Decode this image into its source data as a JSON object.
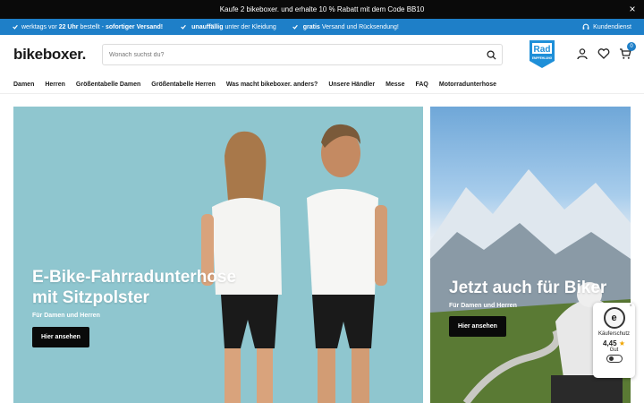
{
  "promo": {
    "text": "Kaufe 2 bikeboxer. und erhalte 10 % Rabatt mit dem Code BB10",
    "close_icon": "×"
  },
  "usp": {
    "items": [
      {
        "pre": "werktags vor",
        "bold": "22 Uhr",
        "post": "bestellt -",
        "bold2": "sofortiger Versand!"
      },
      {
        "pre": "",
        "bold": "unauffällig",
        "post": "unter der Kleidung",
        "bold2": ""
      },
      {
        "pre": "",
        "bold": "gratis",
        "post": "Versand und Rücksendung!",
        "bold2": ""
      }
    ],
    "service": "Kundendienst"
  },
  "header": {
    "logo": "bikeboxer.",
    "search_placeholder": "Wonach suchst du?",
    "badge_text": "Rad",
    "badge_sub": "EMPFEHLUNG",
    "cart_count": "0"
  },
  "nav": [
    "Damen",
    "Herren",
    "Größentabelle Damen",
    "Größentabelle Herren",
    "Was macht bikeboxer. anders?",
    "Unsere Händler",
    "Messe",
    "FAQ",
    "Motorradunterhose"
  ],
  "hero_left": {
    "title_line1": "E-Bike-Fahrradunterhose",
    "title_line2": "mit Sitzpolster",
    "sub": "Für Damen und Herren",
    "button": "Hier ansehen"
  },
  "hero_right": {
    "title": "Jetzt auch für Biker",
    "sub": "Für Damen und Herren",
    "button": "Hier ansehen"
  },
  "trust": {
    "label": "Käuferschutz",
    "rating": "4,45",
    "verdict": "Gut",
    "seal": "e"
  },
  "colors": {
    "accent": "#1e7fc8",
    "promo_bg": "#0a0a0a",
    "hero_bg": "#8fc6cf"
  }
}
